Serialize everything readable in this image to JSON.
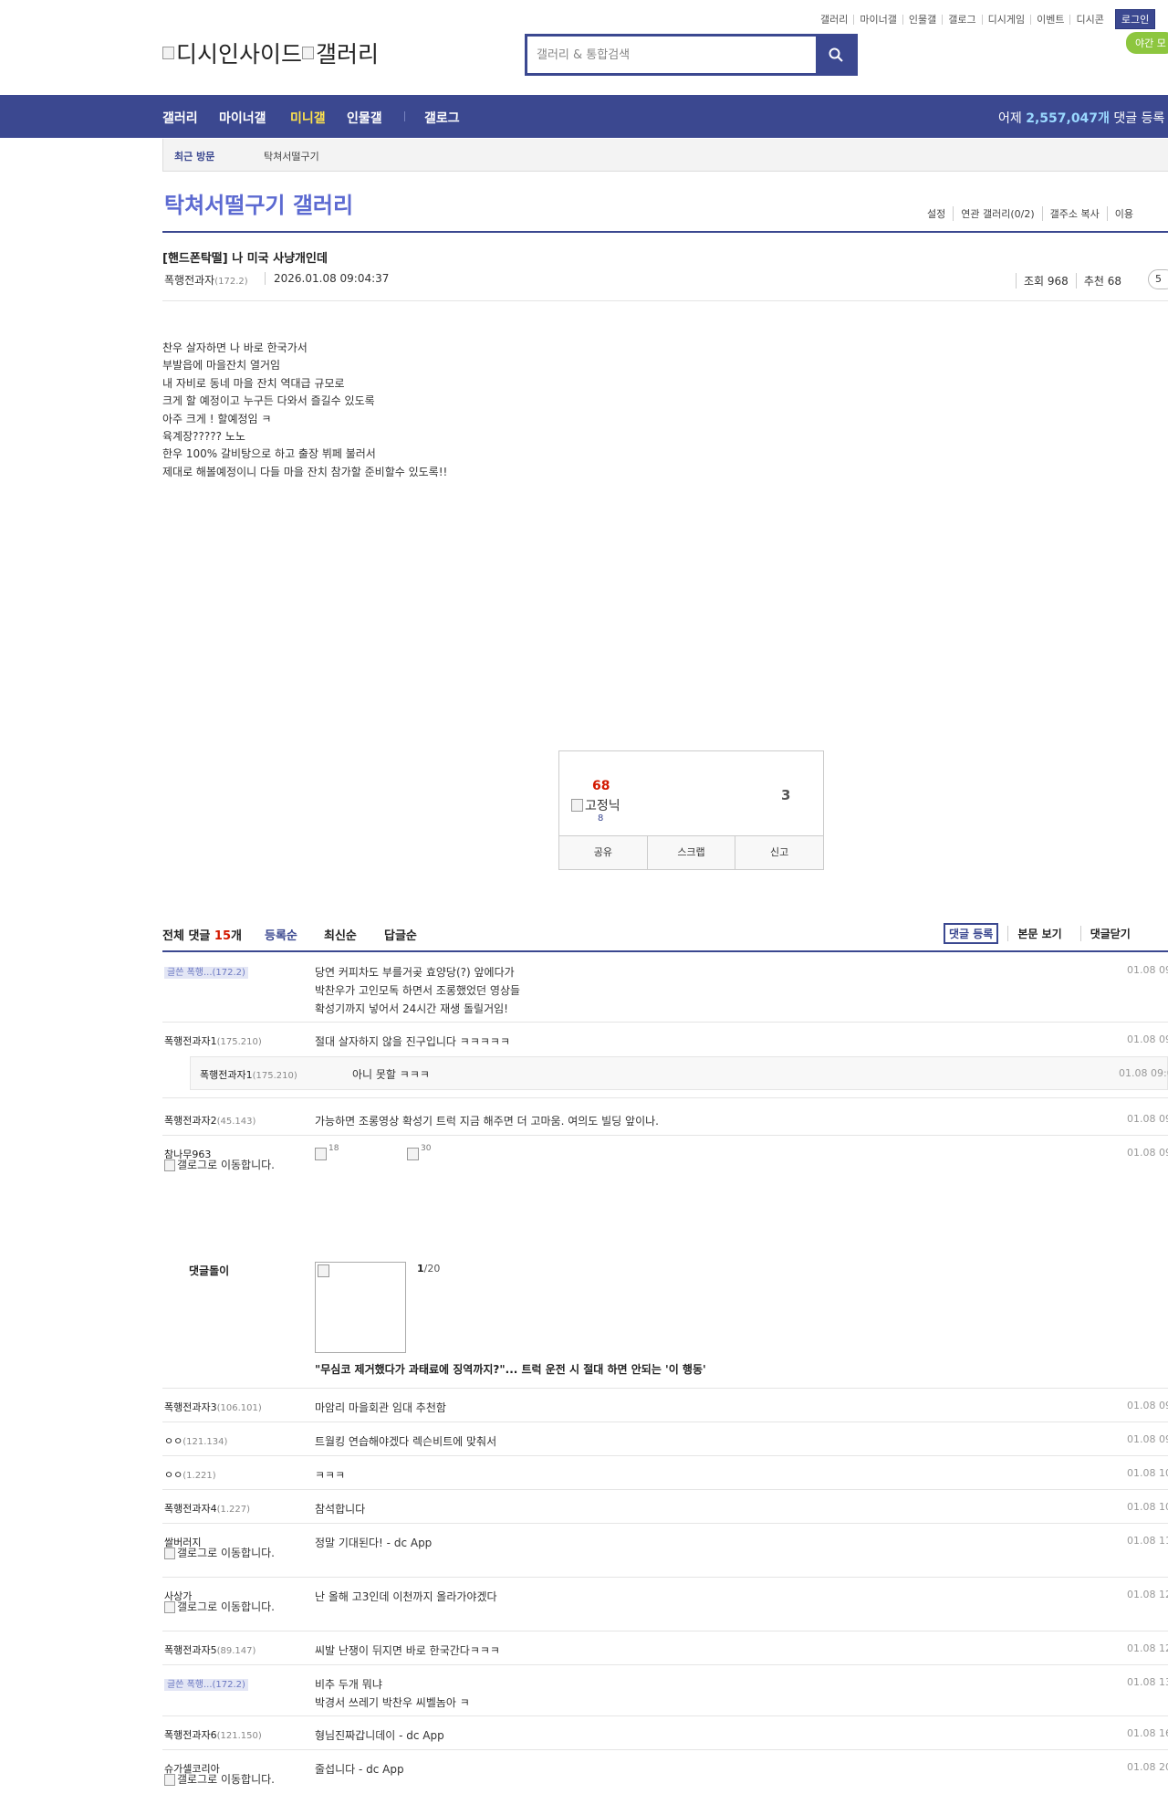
{
  "top_links": [
    "갤러리",
    "마이너갤",
    "인물갤",
    "갤로그",
    "디시게임",
    "이벤트",
    "디시콘"
  ],
  "login_label": "로그인",
  "night_mode_label": "야간 모",
  "logo": {
    "part1": "디시인사이드",
    "part2": "갤러리"
  },
  "search": {
    "placeholder": "갤러리 & 통합검색",
    "icon": "search-icon"
  },
  "nav": {
    "items": [
      "갤러리",
      "마이너갤",
      "미니갤",
      "인물갤",
      "갤로그"
    ],
    "active": "미니갤",
    "stats_prefix": "어제 ",
    "stats_count": "2,557,047개",
    "stats_suffix": " 댓글 등록"
  },
  "recent": {
    "label": "최근 방문",
    "item": "탁쳐서떨구기"
  },
  "gallery": {
    "title": "탁쳐서떨구기 갤러리",
    "menu": [
      "설정",
      "연관 갤러리(0/2)",
      "갤주소 복사",
      "이용"
    ]
  },
  "post": {
    "title": "[핸드폰탁떨] 나 미국 사냥개인데",
    "author": "폭행전과자",
    "author_ip": "(172.2)",
    "date": "2026.01.08 09:04:37",
    "views_label": "조회 968",
    "recommend_label": "추천 68",
    "more_label": "5",
    "body": [
      "찬우 살자하면 나 바로 한국가서",
      "부발읍에 마을잔치 열거임",
      "내 자비로 동네 마을 잔치 역대급 규모로",
      "크게 할 예정이고 누구든 다와서 즐길수 있도록",
      "아주 크게 ! 할예정임 ㅋ",
      "육계장????? 노노",
      "한우 100% 갈비탕으로 하고 출장 뷔페 불러서",
      "제대로 해볼예정이니 다들 마을 잔치 참가할 준비할수 있도록!!"
    ]
  },
  "vote": {
    "up_count": "68",
    "up_image_alt": "고정닉",
    "up_fixed_count": "8",
    "down_count": "3",
    "actions": [
      "공유",
      "스크랩",
      "신고"
    ]
  },
  "comments_header": {
    "total_prefix": "전체 댓글 ",
    "total_count": "15",
    "total_suffix": "개",
    "sorts": [
      "등록순",
      "최신순",
      "답글순"
    ],
    "write_label": "댓글 등록",
    "view_label": "본문 보기",
    "close_label": "댓글닫기"
  },
  "comments": [
    {
      "nick": "글쓴 폭행...(172.2)",
      "lines": [
        "당연 커피차도 부를거곶 효양당(?) 앞에다가",
        "박찬우가 고인모독 하면서 조롱했었던 영상들",
        "확성기까지 넣어서 24시간 재생 돌릴거임!"
      ],
      "date": "01.08 09"
    },
    {
      "nick": "폭행전과자1",
      "ip": "(175.210)",
      "lines": [
        "절대 살자하지 않을 진구입니다 ㅋㅋㅋㅋㅋ"
      ],
      "date": "01.08 09"
    },
    {
      "nick": "폭행전과자1",
      "ip": "(175.210)",
      "lines": [
        "아니 못할 ㅋㅋㅋ"
      ],
      "date": "01.08 09:0"
    },
    {
      "nick": "폭행전과자2",
      "ip": "(45.143)",
      "lines": [
        "가능하면 조롱영상 확성기 트럭 지금 해주면 더 고마움. 여의도 빌딩 앞이나."
      ],
      "date": "01.08 09"
    },
    {
      "nick": "참나무963",
      "gallog_alt": "갤로그로 이동합니다.",
      "dccon": [
        "18",
        "30"
      ],
      "date": "01.08 09"
    },
    {
      "nick": "폭행전과자3",
      "ip": "(106.101)",
      "lines": [
        "마암리 마을회관 임대 추천함"
      ],
      "date": "01.08 09"
    },
    {
      "nick": "ㅇㅇ",
      "ip": "(121.134)",
      "lines": [
        "트월킹 연습해야겠다 렉슨비트에 맞춰서"
      ],
      "date": "01.08 09"
    },
    {
      "nick": "ㅇㅇ",
      "ip": "(1.221)",
      "lines": [
        "ㅋㅋㅋ"
      ],
      "date": "01.08 10"
    },
    {
      "nick": "폭행전과자4",
      "ip": "(1.227)",
      "lines": [
        "참석합니다"
      ],
      "date": "01.08 10"
    },
    {
      "nick": "쌀버러지",
      "gallog_alt": "갤로그로 이동합니다.",
      "lines": [
        "정말 기대된다! - dc App"
      ],
      "date": "01.08 11"
    },
    {
      "nick": "사상가",
      "gallog_alt": "갤로그로 이동합니다.",
      "lines": [
        "난 올해 고3인데 이천까지 올라가야겠다"
      ],
      "date": "01.08 12"
    },
    {
      "nick": "폭행전과자5",
      "ip": "(89.147)",
      "lines": [
        "씨발 난쟁이 뒤지면 바로 한국간다ㅋㅋㅋ"
      ],
      "date": "01.08 12"
    },
    {
      "nick": "글쓴 폭행...(172.2)",
      "lines": [
        "비추 두개 뭐냐",
        "박경서 쓰레기 박찬우 씨벨놈아 ㅋ"
      ],
      "date": "01.08 13"
    },
    {
      "nick": "폭행전과자6",
      "ip": "(121.150)",
      "lines": [
        "형님진짜갑니데이 - dc App"
      ],
      "date": "01.08 16"
    },
    {
      "nick": "슈가셀코리아",
      "gallog_alt": "갤로그로 이동합니다.",
      "lines": [
        "줄섭니다 - dc App"
      ],
      "date": "01.08 20"
    }
  ],
  "ad": {
    "label": "댓글돌이",
    "page_current": "1",
    "page_total": "/20",
    "title": "\"무심코 제거했다가 과태료에 징역까지?\"... 트럭 운전 시 절대 하면 안되는 '이 행동'"
  }
}
